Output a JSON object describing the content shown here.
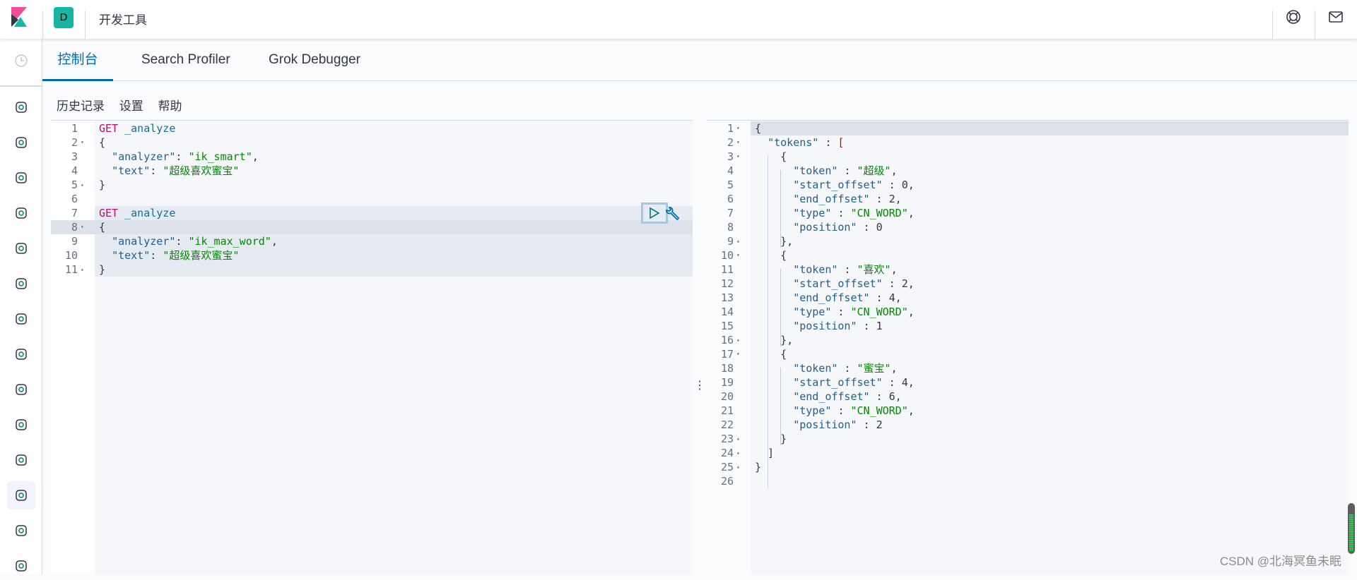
{
  "header": {
    "space_initial": "D",
    "title": "开发工具",
    "icons": [
      "kibana-logo",
      "help-lifebuoy-icon",
      "mail-icon"
    ]
  },
  "sidebar": {
    "items": [
      "recently-viewed",
      "discover",
      "visualize",
      "dashboard",
      "canvas",
      "maps",
      "machine-learning",
      "siem",
      "infrastructure",
      "logs",
      "uptime",
      "apm",
      "dev-tools",
      "stack-monitoring",
      "management"
    ],
    "active": "dev-tools"
  },
  "tabs": [
    {
      "label": "控制台",
      "active": true
    },
    {
      "label": "Search Profiler",
      "active": false
    },
    {
      "label": "Grok Debugger",
      "active": false
    }
  ],
  "toolbar": {
    "history": "历史记录",
    "settings": "设置",
    "help": "帮助"
  },
  "request_editor": {
    "lines": [
      {
        "n": "1",
        "fold": "",
        "tokens": [
          [
            "GET",
            "method"
          ],
          [
            " _analyze",
            "url"
          ]
        ]
      },
      {
        "n": "2",
        "fold": "▾",
        "tokens": [
          [
            "{",
            "punc"
          ]
        ]
      },
      {
        "n": "3",
        "fold": "",
        "tokens": [
          [
            "  ",
            "punc"
          ],
          [
            "\"analyzer\"",
            "key"
          ],
          [
            ": ",
            "punc"
          ],
          [
            "\"ik_smart\"",
            "str"
          ],
          [
            ",",
            "punc"
          ]
        ]
      },
      {
        "n": "4",
        "fold": "",
        "tokens": [
          [
            "  ",
            "punc"
          ],
          [
            "\"text\"",
            "key"
          ],
          [
            ": ",
            "punc"
          ],
          [
            "\"超级喜欢蜜宝\"",
            "str"
          ]
        ]
      },
      {
        "n": "5",
        "fold": "▴",
        "tokens": [
          [
            "}",
            "punc"
          ]
        ]
      },
      {
        "n": "6",
        "fold": "",
        "tokens": []
      },
      {
        "n": "7",
        "fold": "",
        "tokens": [
          [
            "GET",
            "method"
          ],
          [
            " _analyze",
            "url"
          ]
        ]
      },
      {
        "n": "8",
        "fold": "▾",
        "tokens": [
          [
            "{",
            "punc"
          ]
        ]
      },
      {
        "n": "9",
        "fold": "",
        "tokens": [
          [
            "  ",
            "punc"
          ],
          [
            "\"analyzer\"",
            "key"
          ],
          [
            ": ",
            "punc"
          ],
          [
            "\"ik_max_word\"",
            "str"
          ],
          [
            ",",
            "punc"
          ]
        ]
      },
      {
        "n": "10",
        "fold": "",
        "tokens": [
          [
            "  ",
            "punc"
          ],
          [
            "\"text\"",
            "key"
          ],
          [
            ": ",
            "punc"
          ],
          [
            "\"超级喜欢蜜宝\"",
            "str"
          ]
        ]
      },
      {
        "n": "11",
        "fold": "▴",
        "tokens": [
          [
            "}",
            "punc"
          ]
        ]
      }
    ],
    "highlighted_request_lines": [
      "7",
      "8",
      "9",
      "10",
      "11"
    ],
    "active_line": "8"
  },
  "response_editor": {
    "lines": [
      {
        "n": "1",
        "fold": "▾",
        "tokens": [
          [
            "{",
            "punc"
          ]
        ]
      },
      {
        "n": "2",
        "fold": "▾",
        "tokens": [
          [
            "  ",
            "punc"
          ],
          [
            "\"tokens\"",
            "key"
          ],
          [
            " : ",
            "punc"
          ],
          [
            "[",
            "brk"
          ]
        ]
      },
      {
        "n": "3",
        "fold": "▾",
        "tokens": [
          [
            "    {",
            "punc"
          ]
        ]
      },
      {
        "n": "4",
        "fold": "",
        "tokens": [
          [
            "      ",
            "punc"
          ],
          [
            "\"token\"",
            "key"
          ],
          [
            " : ",
            "punc"
          ],
          [
            "\"超级\"",
            "str"
          ],
          [
            ",",
            "punc"
          ]
        ]
      },
      {
        "n": "5",
        "fold": "",
        "tokens": [
          [
            "      ",
            "punc"
          ],
          [
            "\"start_offset\"",
            "key"
          ],
          [
            " : 0,",
            "num"
          ]
        ]
      },
      {
        "n": "6",
        "fold": "",
        "tokens": [
          [
            "      ",
            "punc"
          ],
          [
            "\"end_offset\"",
            "key"
          ],
          [
            " : 2,",
            "num"
          ]
        ]
      },
      {
        "n": "7",
        "fold": "",
        "tokens": [
          [
            "      ",
            "punc"
          ],
          [
            "\"type\"",
            "key"
          ],
          [
            " : ",
            "punc"
          ],
          [
            "\"CN_WORD\"",
            "str"
          ],
          [
            ",",
            "punc"
          ]
        ]
      },
      {
        "n": "8",
        "fold": "",
        "tokens": [
          [
            "      ",
            "punc"
          ],
          [
            "\"position\"",
            "key"
          ],
          [
            " : 0",
            "num"
          ]
        ]
      },
      {
        "n": "9",
        "fold": "▴",
        "tokens": [
          [
            "    },",
            "punc"
          ]
        ]
      },
      {
        "n": "10",
        "fold": "▾",
        "tokens": [
          [
            "    {",
            "punc"
          ]
        ]
      },
      {
        "n": "11",
        "fold": "",
        "tokens": [
          [
            "      ",
            "punc"
          ],
          [
            "\"token\"",
            "key"
          ],
          [
            " : ",
            "punc"
          ],
          [
            "\"喜欢\"",
            "str"
          ],
          [
            ",",
            "punc"
          ]
        ]
      },
      {
        "n": "12",
        "fold": "",
        "tokens": [
          [
            "      ",
            "punc"
          ],
          [
            "\"start_offset\"",
            "key"
          ],
          [
            " : 2,",
            "num"
          ]
        ]
      },
      {
        "n": "13",
        "fold": "",
        "tokens": [
          [
            "      ",
            "punc"
          ],
          [
            "\"end_offset\"",
            "key"
          ],
          [
            " : 4,",
            "num"
          ]
        ]
      },
      {
        "n": "14",
        "fold": "",
        "tokens": [
          [
            "      ",
            "punc"
          ],
          [
            "\"type\"",
            "key"
          ],
          [
            " : ",
            "punc"
          ],
          [
            "\"CN_WORD\"",
            "str"
          ],
          [
            ",",
            "punc"
          ]
        ]
      },
      {
        "n": "15",
        "fold": "",
        "tokens": [
          [
            "      ",
            "punc"
          ],
          [
            "\"position\"",
            "key"
          ],
          [
            " : 1",
            "num"
          ]
        ]
      },
      {
        "n": "16",
        "fold": "▴",
        "tokens": [
          [
            "    },",
            "punc"
          ]
        ]
      },
      {
        "n": "17",
        "fold": "▾",
        "tokens": [
          [
            "    {",
            "punc"
          ]
        ]
      },
      {
        "n": "18",
        "fold": "",
        "tokens": [
          [
            "      ",
            "punc"
          ],
          [
            "\"token\"",
            "key"
          ],
          [
            " : ",
            "punc"
          ],
          [
            "\"蜜宝\"",
            "str"
          ],
          [
            ",",
            "punc"
          ]
        ]
      },
      {
        "n": "19",
        "fold": "",
        "tokens": [
          [
            "      ",
            "punc"
          ],
          [
            "\"start_offset\"",
            "key"
          ],
          [
            " : 4,",
            "num"
          ]
        ]
      },
      {
        "n": "20",
        "fold": "",
        "tokens": [
          [
            "      ",
            "punc"
          ],
          [
            "\"end_offset\"",
            "key"
          ],
          [
            " : 6,",
            "num"
          ]
        ]
      },
      {
        "n": "21",
        "fold": "",
        "tokens": [
          [
            "      ",
            "punc"
          ],
          [
            "\"type\"",
            "key"
          ],
          [
            " : ",
            "punc"
          ],
          [
            "\"CN_WORD\"",
            "str"
          ],
          [
            ",",
            "punc"
          ]
        ]
      },
      {
        "n": "22",
        "fold": "",
        "tokens": [
          [
            "      ",
            "punc"
          ],
          [
            "\"position\"",
            "key"
          ],
          [
            " : 2",
            "num"
          ]
        ]
      },
      {
        "n": "23",
        "fold": "▴",
        "tokens": [
          [
            "    }",
            "punc"
          ]
        ]
      },
      {
        "n": "24",
        "fold": "▴",
        "tokens": [
          [
            "  ]",
            "punc"
          ]
        ]
      },
      {
        "n": "25",
        "fold": "▴",
        "tokens": [
          [
            "}",
            "punc"
          ]
        ]
      },
      {
        "n": "26",
        "fold": "",
        "tokens": []
      }
    ],
    "active_line": "1"
  },
  "divider_glyph": "⋮",
  "watermark": "CSDN @北海冥鱼未眠",
  "colors": {
    "accent": "#006bb4",
    "method": "#c80a68",
    "string": "#018a00",
    "key": "#23608c"
  }
}
